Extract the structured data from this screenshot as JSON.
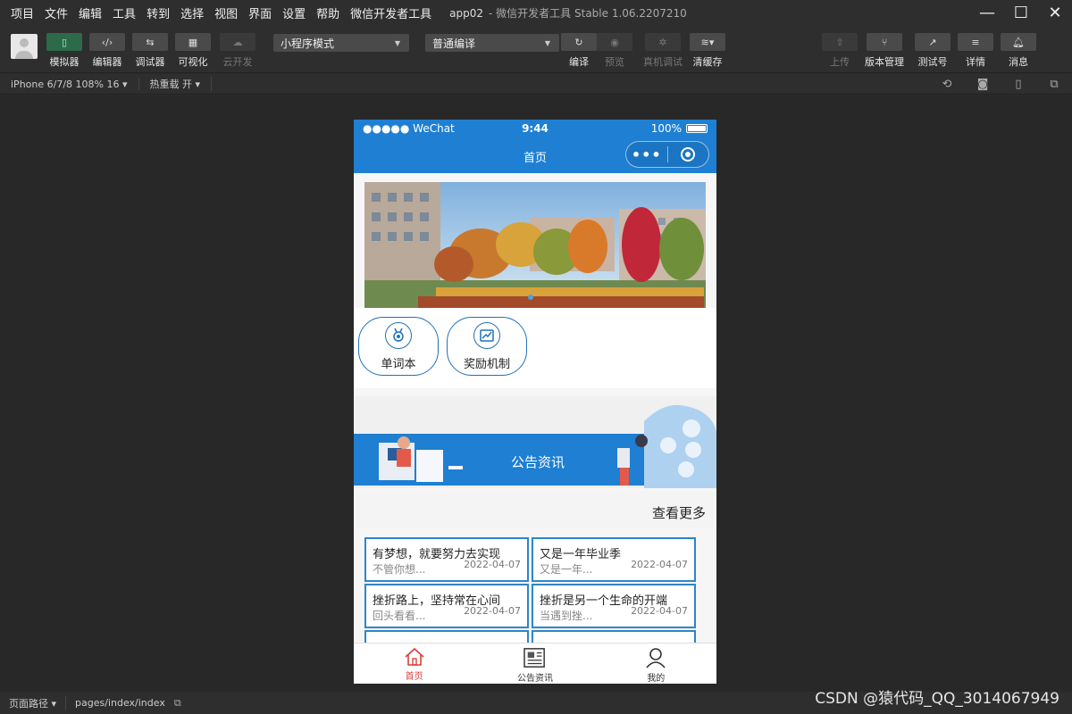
{
  "menu": [
    "项目",
    "文件",
    "编辑",
    "工具",
    "转到",
    "选择",
    "视图",
    "界面",
    "设置",
    "帮助",
    "微信开发者工具"
  ],
  "window_title": {
    "project": "app02",
    "app": "- 微信开发者工具 Stable 1.06.2207210"
  },
  "toolbar": {
    "simulator": "模拟器",
    "editor": "编辑器",
    "debugger": "调试器",
    "visual": "可视化",
    "cloud": "云开发",
    "mode_select": "小程序模式",
    "compile_select": "普通编译",
    "compile": "编译",
    "preview": "预览",
    "remote_debug": "真机调试",
    "clear_cache": "清缓存",
    "upload": "上传",
    "version": "版本管理",
    "test": "测试号",
    "details": "详情",
    "messages": "消息"
  },
  "subbar": {
    "device": "iPhone 6/7/8 108% 16 ▾",
    "hot_reload": "热重载 开 ▾"
  },
  "phone": {
    "status": {
      "carrier": "●●●●● WeChat",
      "time": "9:44",
      "battery": "100%"
    },
    "nav_title": "首页",
    "features": [
      {
        "label": "单词本",
        "icon": "medal-icon"
      },
      {
        "label": "奖励机制",
        "icon": "chart-icon"
      }
    ],
    "notice_title": "公告资讯",
    "more": "查看更多",
    "cards": [
      {
        "title": "有梦想，就要努力去实现",
        "summary": "不管你想...",
        "date": "2022-04-07"
      },
      {
        "title": "又是一年毕业季",
        "summary": "又是一年...",
        "date": "2022-04-07"
      },
      {
        "title": "挫折路上，坚持常在心间",
        "summary": "回头看看...",
        "date": "2022-04-07"
      },
      {
        "title": "挫折是另一个生命的开端",
        "summary": "当遇到挫...",
        "date": "2022-04-07"
      }
    ],
    "tabs": [
      {
        "label": "首页",
        "icon": "home-icon"
      },
      {
        "label": "公告资讯",
        "icon": "news-icon"
      },
      {
        "label": "我的",
        "icon": "user-icon"
      }
    ]
  },
  "footer": {
    "path_label": "页面路径 ▾",
    "path": "pages/index/index"
  },
  "watermark": "CSDN @猿代码_QQ_3014067949"
}
